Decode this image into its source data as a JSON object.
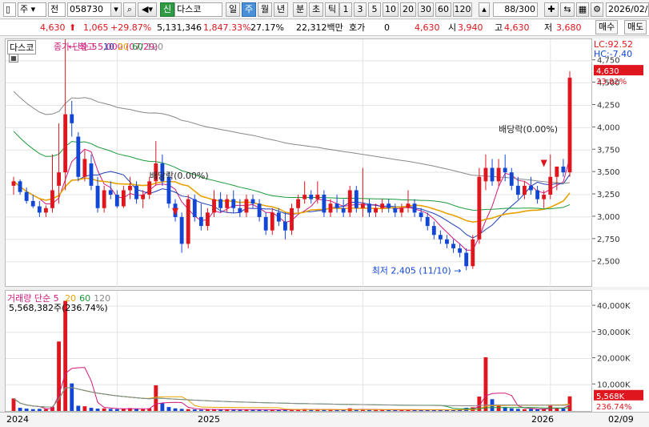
{
  "toolbar": {
    "market": "주",
    "prev": "전",
    "code": "058730",
    "sin": "신",
    "name": "다스코",
    "periods": [
      "일",
      "주",
      "월",
      "년",
      "분",
      "초",
      "틱"
    ],
    "active_period": "주",
    "numbers": [
      "1",
      "3",
      "5",
      "10",
      "20",
      "30",
      "60",
      "120"
    ],
    "count": "88/300",
    "date": "2026/02/"
  },
  "quote": {
    "price": "4,630",
    "change": "1,065",
    "change_pct": "+29.87%",
    "volume": "5,131,346",
    "volume_pct": "1,847.33%",
    "turnover_pct": "27.17%",
    "amount": "22,312백만",
    "ask_label": "호가",
    "ask_value": "0",
    "ask_price": "4,630",
    "open_label": "시",
    "open": "3,940",
    "high_label": "고",
    "high": "4,630",
    "low_label": "저",
    "low": "3,680",
    "buy": "매수",
    "sell": "매도"
  },
  "price_panel": {
    "stock_label": "다스코",
    "legend_prefix": "종가 단순 5",
    "ma": [
      {
        "label": "10",
        "color": "#1f3fb5"
      },
      {
        "label": "20",
        "color": "#e8a200"
      },
      {
        "label": "60",
        "color": "#1a9a3a"
      },
      {
        "label": "120",
        "color": "#888888"
      }
    ],
    "lc": "LC:92.52",
    "hc": "HC:-7.40",
    "current_price": "4,630",
    "current_pct": "33.82%",
    "high_note": "최고 5,000 (07/29)",
    "low_note": "최저 2,405 (11/10)",
    "div_note1": "배당락(0.00%)",
    "div_note2": "배당락(0.00%)"
  },
  "volume_panel": {
    "legend_label": "거래량",
    "legend_prefix": "단순 5",
    "ma": [
      {
        "label": "20",
        "color": "#e8a200"
      },
      {
        "label": "60",
        "color": "#1a9a3a"
      },
      {
        "label": "120",
        "color": "#888888"
      }
    ],
    "value_text": "5,568,382주(236.74%)",
    "current": "5,568K",
    "current_pct": "236.74%"
  },
  "dates": [
    "2024",
    "2025",
    "2026",
    "02/09"
  ],
  "colors": {
    "up": "#e0161e",
    "down": "#1246d4"
  },
  "chart_data": {
    "type": "candlestick",
    "price_ticks": [
      4750,
      4500,
      4250,
      4000,
      3750,
      3500,
      3250,
      3000,
      2750,
      2500
    ],
    "ylim": [
      2300,
      4900
    ],
    "volume_ticks": [
      "40,000K",
      "30,000K",
      "20,000K",
      "10,000K"
    ],
    "volume_ylim": [
      0,
      44000
    ],
    "candles": [
      [
        3350,
        3450,
        3250,
        3400
      ],
      [
        3400,
        3420,
        3250,
        3280
      ],
      [
        3280,
        3330,
        3150,
        3180
      ],
      [
        3180,
        3250,
        3100,
        3120
      ],
      [
        3120,
        3180,
        3000,
        3050
      ],
      [
        3050,
        3130,
        3000,
        3100
      ],
      [
        3100,
        3700,
        3050,
        3300
      ],
      [
        3350,
        4050,
        3150,
        3500
      ],
      [
        3500,
        5000,
        3300,
        4150
      ],
      [
        4150,
        4300,
        3900,
        4050
      ],
      [
        3900,
        3950,
        3400,
        3450
      ],
      [
        3450,
        3750,
        3400,
        3650
      ],
      [
        3600,
        3700,
        3300,
        3350
      ],
      [
        3350,
        3450,
        3050,
        3100
      ],
      [
        3100,
        3350,
        3050,
        3300
      ],
      [
        3300,
        3400,
        3200,
        3250
      ],
      [
        3250,
        3300,
        3100,
        3120
      ],
      [
        3120,
        3350,
        3100,
        3300
      ],
      [
        3300,
        3450,
        3200,
        3350
      ],
      [
        3350,
        3400,
        3150,
        3200
      ],
      [
        3200,
        3300,
        3100,
        3250
      ],
      [
        3250,
        3450,
        3200,
        3400
      ],
      [
        3400,
        3850,
        3350,
        3600
      ],
      [
        3600,
        3700,
        3350,
        3400
      ],
      [
        3450,
        3500,
        3100,
        3150
      ],
      [
        3150,
        3200,
        2950,
        3000
      ],
      [
        3000,
        3050,
        2600,
        2700
      ],
      [
        2700,
        3250,
        2650,
        3200
      ],
      [
        3200,
        3250,
        2950,
        3000
      ],
      [
        3000,
        3150,
        2850,
        2900
      ],
      [
        2900,
        3100,
        2850,
        3050
      ],
      [
        3050,
        3300,
        3000,
        3200
      ],
      [
        3200,
        3280,
        3050,
        3100
      ],
      [
        3100,
        3250,
        3050,
        3200
      ],
      [
        3200,
        3300,
        3050,
        3100
      ],
      [
        3100,
        3200,
        3000,
        3050
      ],
      [
        3050,
        3250,
        3000,
        3200
      ],
      [
        3200,
        3250,
        3100,
        3150
      ],
      [
        3150,
        3200,
        2950,
        3000
      ],
      [
        3000,
        3050,
        2800,
        2850
      ],
      [
        2850,
        3100,
        2800,
        3050
      ],
      [
        3050,
        3100,
        2900,
        2950
      ],
      [
        2950,
        3050,
        2750,
        2850
      ],
      [
        2850,
        3150,
        2800,
        3100
      ],
      [
        3100,
        3250,
        3050,
        3200
      ],
      [
        3200,
        3400,
        3150,
        3250
      ],
      [
        3250,
        3300,
        3150,
        3200
      ],
      [
        3200,
        3400,
        3150,
        3250
      ],
      [
        3250,
        3300,
        3000,
        3050
      ],
      [
        3050,
        3200,
        3000,
        3150
      ],
      [
        3150,
        3250,
        3050,
        3100
      ],
      [
        3100,
        3200,
        3000,
        3050
      ],
      [
        3050,
        3350,
        3000,
        3300
      ],
      [
        3300,
        3350,
        3050,
        3100
      ],
      [
        3100,
        3550,
        3000,
        3150
      ],
      [
        3150,
        3200,
        3000,
        3050
      ],
      [
        3050,
        3150,
        3000,
        3100
      ],
      [
        3100,
        3200,
        3050,
        3150
      ],
      [
        3150,
        3200,
        3050,
        3100
      ],
      [
        3100,
        3150,
        3000,
        3050
      ],
      [
        3050,
        3150,
        3000,
        3100
      ],
      [
        3100,
        3300,
        3050,
        3150
      ],
      [
        3150,
        3200,
        3000,
        3050
      ],
      [
        3050,
        3100,
        2950,
        3000
      ],
      [
        3000,
        3050,
        2850,
        2900
      ],
      [
        2900,
        2950,
        2750,
        2800
      ],
      [
        2800,
        2850,
        2700,
        2750
      ],
      [
        2750,
        2800,
        2650,
        2700
      ],
      [
        2700,
        2750,
        2600,
        2650
      ],
      [
        2650,
        2700,
        2550,
        2600
      ],
      [
        2600,
        2650,
        2405,
        2450
      ],
      [
        2450,
        2800,
        2420,
        2750
      ],
      [
        2750,
        3550,
        2700,
        3450
      ],
      [
        3400,
        3700,
        3300,
        3550
      ],
      [
        3550,
        3650,
        3350,
        3400
      ],
      [
        3400,
        3650,
        3350,
        3550
      ],
      [
        3550,
        3700,
        3400,
        3500
      ],
      [
        3500,
        3550,
        3300,
        3350
      ],
      [
        3350,
        3450,
        3200,
        3250
      ],
      [
        3250,
        3400,
        3200,
        3350
      ],
      [
        3350,
        3450,
        3250,
        3300
      ],
      [
        3300,
        3350,
        3150,
        3200
      ],
      [
        3200,
        3300,
        3100,
        3250
      ],
      [
        3250,
        3700,
        3200,
        3450
      ],
      [
        3450,
        3550,
        3300,
        3565
      ],
      [
        3565,
        3650,
        3450,
        3500
      ],
      [
        3500,
        4630,
        3450,
        4560
      ]
    ],
    "volumes": [
      4800,
      1200,
      900,
      700,
      800,
      700,
      1500,
      26500,
      42000,
      10500,
      2000,
      1800,
      1200,
      900,
      1000,
      800,
      700,
      900,
      1100,
      800,
      700,
      1000,
      9800,
      3000,
      1500,
      1000,
      800,
      700,
      600,
      500,
      600,
      700,
      500,
      600,
      500,
      500,
      600,
      500,
      500,
      400,
      500,
      400,
      500,
      600,
      500,
      800,
      500,
      500,
      500,
      400,
      500,
      400,
      1000,
      500,
      600,
      400,
      400,
      500,
      400,
      400,
      400,
      500,
      400,
      400,
      500,
      400,
      400,
      400,
      500,
      500,
      1200,
      1400,
      5500,
      20500,
      4500,
      2000,
      1500,
      1000,
      800,
      700,
      800,
      600,
      700,
      2000,
      1200,
      1000,
      5568
    ]
  }
}
